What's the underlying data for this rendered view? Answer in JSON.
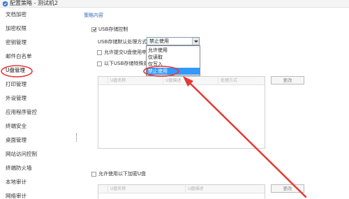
{
  "window": {
    "title": "配置策略 - 测试机2"
  },
  "sidebar": {
    "items": [
      {
        "label": "文档加密"
      },
      {
        "label": "加密权限"
      },
      {
        "label": "密钥管理"
      },
      {
        "label": "邮件白名单"
      },
      {
        "label": "U盘管理"
      },
      {
        "label": "打印管理"
      },
      {
        "label": "外设管理"
      },
      {
        "label": "应用程序管控"
      },
      {
        "label": "终端安全"
      },
      {
        "label": "桌面管理"
      },
      {
        "label": "网站访问控制"
      },
      {
        "label": "终端防火墙"
      },
      {
        "label": "本地审计"
      },
      {
        "label": "网络审计"
      }
    ],
    "active_index": 4
  },
  "content": {
    "section_title": "策略内容",
    "usb_control_label": "USB存储控制",
    "default_mode_label": "USB存储默认处理方式",
    "select_value": "禁止使用",
    "options": [
      "允许使用",
      "仅读取",
      "仅写入",
      "禁止使用"
    ],
    "selected_option_index": 3,
    "allow_submit_label": "允许提交U盘使用申",
    "special_label": "以下USB存储特殊处",
    "top_table": {
      "columns": [
        "",
        "U盘名称",
        "U盘描述",
        "处理方式"
      ],
      "edit_button": "更改"
    },
    "allow_encrypted_label": "允许使用以下加密U盘",
    "bottom_table": {
      "columns": [
        "",
        "U盘名称",
        "U盘描述"
      ],
      "edit_button": "更改"
    }
  },
  "annotation_color": "#e53935"
}
